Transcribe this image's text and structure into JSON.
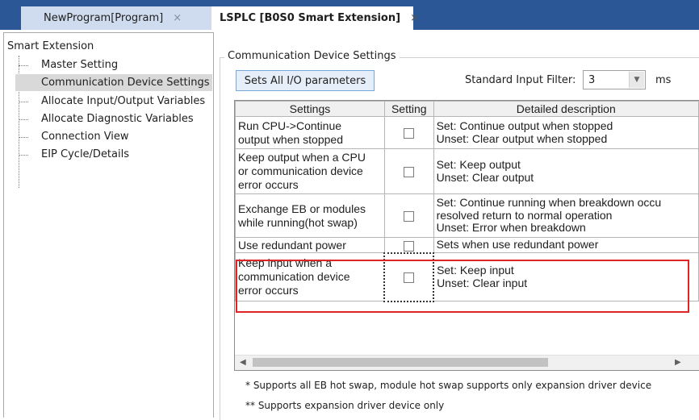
{
  "tabs": [
    {
      "label": "NewProgram[Program]",
      "close": "×",
      "active": false
    },
    {
      "label": "LSPLC [B0S0 Smart Extension]",
      "close": "×",
      "active": true
    }
  ],
  "tree": {
    "root": "Smart Extension",
    "items": [
      {
        "label": "Master Setting",
        "selected": false
      },
      {
        "label": "Communication Device Settings",
        "selected": true
      },
      {
        "label": "Allocate Input/Output Variables",
        "selected": false
      },
      {
        "label": "Allocate Diagnostic Variables",
        "selected": false
      },
      {
        "label": "Connection View",
        "selected": false
      },
      {
        "label": "EIP Cycle/Details",
        "selected": false
      }
    ]
  },
  "group": {
    "title": "Communication Device Settings",
    "set_all_button": "Sets All I/O parameters",
    "filter_label": "Standard Input Filter:",
    "filter_value": "3",
    "filter_unit": "ms"
  },
  "grid": {
    "headers": [
      "Settings",
      "Setting",
      "Detailed description"
    ],
    "rows": [
      {
        "setting": [
          "Run CPU->Continue",
          "output when stopped"
        ],
        "checked": false,
        "desc": [
          "Set: Continue output when stopped",
          "Unset: Clear output when stopped"
        ]
      },
      {
        "setting": [
          "Keep output when a CPU",
          "or communication device",
          "error occurs"
        ],
        "checked": false,
        "desc": [
          "Set: Keep output",
          "Unset: Clear output"
        ]
      },
      {
        "setting": [
          "Exchange EB or modules",
          "while running(hot swap)"
        ],
        "checked": false,
        "desc": [
          "Set: Continue running when breakdown occu",
          "resolved return to normal operation",
          "Unset: Error when breakdown"
        ]
      },
      {
        "setting": [
          "Use redundant power"
        ],
        "checked": false,
        "desc": [
          "Sets when use redundant power"
        ]
      },
      {
        "setting": [
          "Keep input when a",
          "communication device",
          "error occurs"
        ],
        "checked": false,
        "desc": [
          "Set: Keep input",
          "Unset: Clear input"
        ],
        "highlighted": true
      }
    ]
  },
  "notes": [
    "* Supports all EB hot swap, module hot swap supports only expansion driver device",
    "** Supports expansion driver device only"
  ],
  "highlight_color": "#e02424",
  "accent_color": "#2b5797"
}
